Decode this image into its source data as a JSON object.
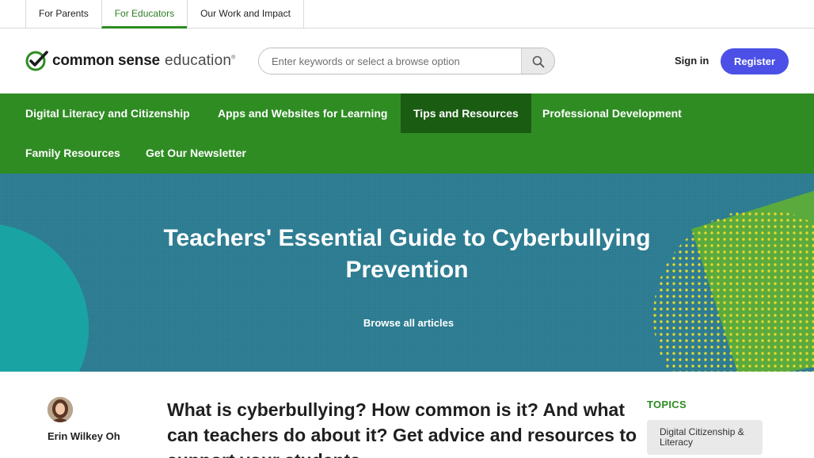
{
  "audience_tabs": [
    {
      "label": "For Parents"
    },
    {
      "label": "For Educators"
    },
    {
      "label": "Our Work and Impact"
    }
  ],
  "logo": {
    "main": "common sense",
    "sub": "education",
    "reg": "®"
  },
  "search": {
    "placeholder": "Enter keywords or select a browse option"
  },
  "header": {
    "sign_in": "Sign in",
    "register": "Register"
  },
  "nav": {
    "items": [
      {
        "label": "Digital Literacy and Citizenship"
      },
      {
        "label": "Apps and Websites for Learning"
      },
      {
        "label": "Tips and Resources"
      },
      {
        "label": "Professional Development"
      },
      {
        "label": "Family Resources"
      },
      {
        "label": "Get Our Newsletter"
      }
    ]
  },
  "hero": {
    "title": "Teachers' Essential Guide to Cyberbullying Prevention",
    "browse_link": "Browse all articles"
  },
  "article": {
    "author": "Erin Wilkey Oh",
    "intro": "What is cyberbullying? How common is it? And what can teachers do about it? Get advice and resources to support your students."
  },
  "topics": {
    "label": "TOPICS",
    "items": [
      {
        "label": "Digital Citizenship & Literacy"
      }
    ]
  },
  "colors": {
    "brand_green": "#2f8c23",
    "nav_active": "#1b5c13",
    "register_blue": "#4c50e6",
    "hero_teal": "#2a7a90"
  }
}
